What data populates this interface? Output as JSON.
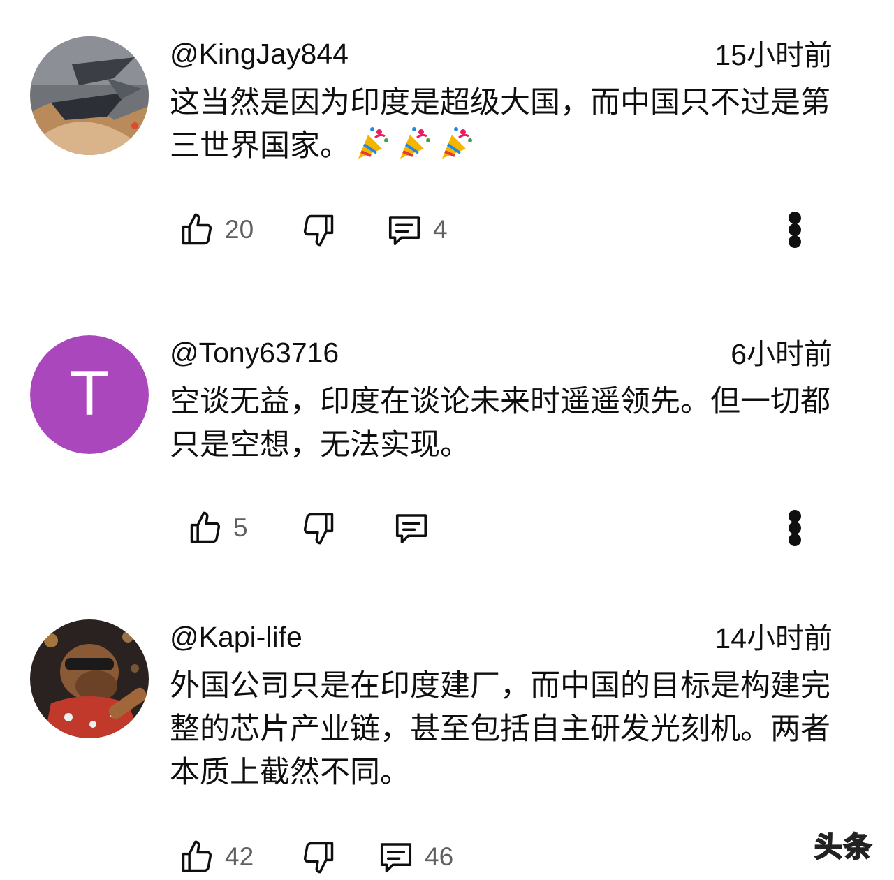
{
  "comments": [
    {
      "author": "@KingJay844",
      "time": "15小时前",
      "text": "这当然是因为印度是超级大国，而中国只不过是第三世界国家。",
      "emoji": [
        "party-popper",
        "party-popper",
        "party-popper"
      ],
      "likes": "20",
      "replies": "4"
    },
    {
      "author": "@Tony63716",
      "avatar_letter": "T",
      "avatar_color": "#ab47bc",
      "time": "6小时前",
      "text": "空谈无益，印度在谈论未来时遥遥领先。但一切都只是空想，无法实现。",
      "likes": "5"
    },
    {
      "author": "@Kapi-life",
      "time": "14小时前",
      "text": "外国公司只是在印度建厂，而中国的目标是构建完整的芯片产业链，甚至包括自主研发光刻机。两者本质上截然不同。",
      "likes": "42",
      "replies": "46"
    }
  ],
  "watermark": "头条"
}
